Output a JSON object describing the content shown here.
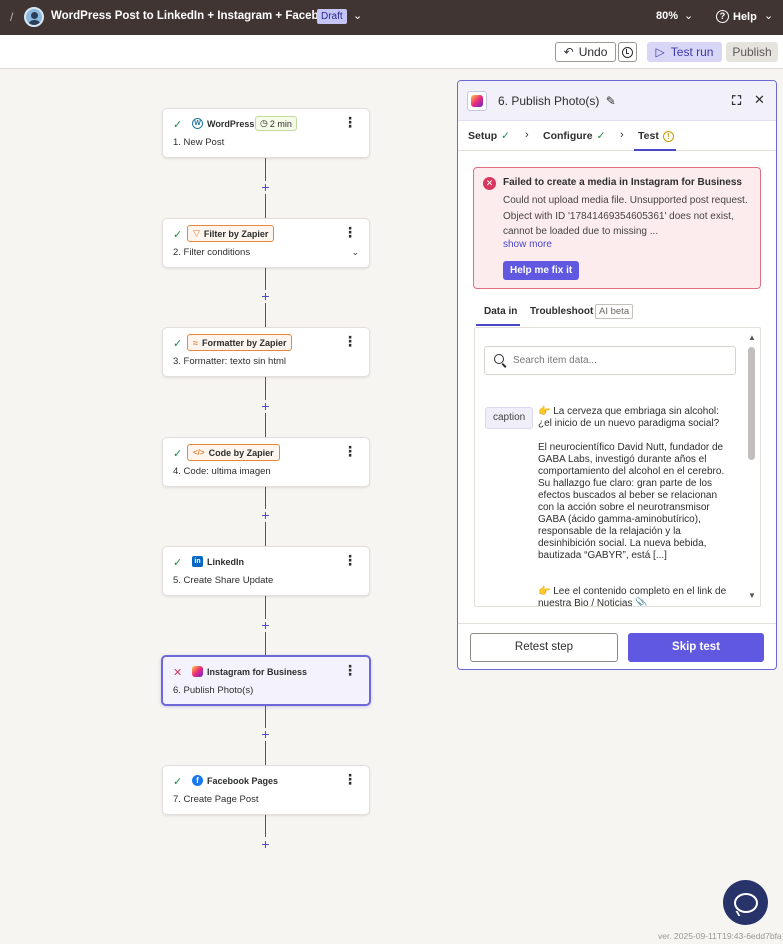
{
  "topbar": {
    "title": "WordPress Post to LinkedIn + Instagram + Facebook",
    "status": "Draft",
    "zoom": "80%",
    "help": "Help"
  },
  "toolbar": {
    "undo": "Undo",
    "test_run": "Test run",
    "publish": "Publish"
  },
  "steps": [
    {
      "app": "WordPress",
      "label": "1. New Post",
      "status": "success",
      "duration": "2 min"
    },
    {
      "app": "Filter by Zapier",
      "label": "2. Filter conditions",
      "status": "success"
    },
    {
      "app": "Formatter by Zapier",
      "label": "3. Formatter: texto sin html",
      "status": "success"
    },
    {
      "app": "Code by Zapier",
      "label": "4. Code: ultima imagen",
      "status": "success"
    },
    {
      "app": "LinkedIn",
      "label": "5. Create Share Update",
      "status": "success"
    },
    {
      "app": "Instagram for Business",
      "label": "6. Publish Photo(s)",
      "status": "error"
    },
    {
      "app": "Facebook Pages",
      "label": "7. Create Page Post",
      "status": "success"
    }
  ],
  "panel": {
    "title": "6. Publish Photo(s)",
    "tabs": [
      "Setup",
      "Configure",
      "Test"
    ],
    "error": {
      "title": "Failed to create a media in Instagram for Business",
      "message": "Could not upload media file. Unsupported post request. Object with ID '17841469354605361' does not exist, cannot be loaded due to missing ...",
      "show_more": "show more",
      "fix_button": "Help me fix it"
    },
    "subtabs": {
      "data_in": "Data in",
      "troubleshoot": "Troubleshoot",
      "beta": "AI beta"
    },
    "search_placeholder": "Search item data...",
    "caption_key": "caption",
    "caption_value": "👉 La cerveza que embriaga sin alcohol: ¿el inicio de un nuevo paradigma social?\n\nEl neurocientífico David Nutt, fundador de GABA Labs, investigó durante años el comportamiento del alcohol en el cerebro. Su hallazgo fue claro: gran parte de los efectos buscados al beber se relacionan con la acción sobre el neurotransmisor GABA (ácido gamma-aminobutírico), responsable de la relajación y la desinhibición social. La nueva bebida, bautizada “GABYR”, está [...]\n\n\n👉 Lee el contenido completo en el link de nuestra Bio / Noticias 📎",
    "retest": "Retest step",
    "skip": "Skip test"
  },
  "version": "ver. 2025-09-11T19:43-6edd7bfa"
}
